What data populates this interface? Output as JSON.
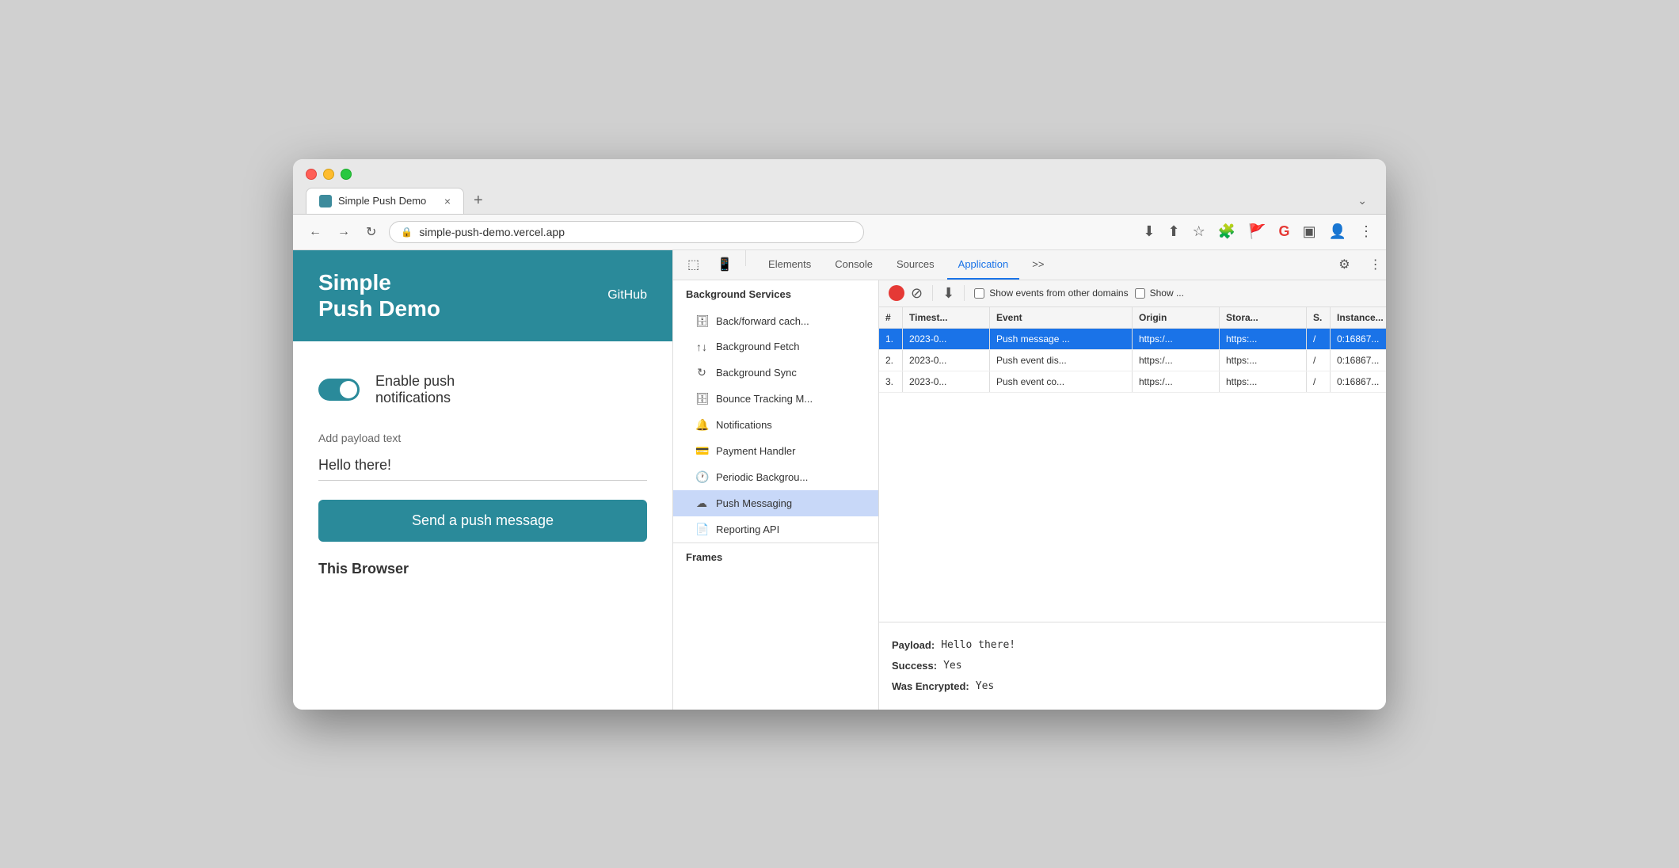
{
  "browser": {
    "tab_title": "Simple Push Demo",
    "tab_close": "×",
    "tab_new": "+",
    "tab_chevron": "⌄",
    "url": "simple-push-demo.vercel.app",
    "nav": {
      "back": "←",
      "forward": "→",
      "refresh": "↻"
    }
  },
  "website": {
    "title_line1": "Simple",
    "title_line2": "Push Demo",
    "github_label": "GitHub",
    "toggle_label": "Enable push\nnotifications",
    "payload_label": "Add payload text",
    "payload_value": "Hello there!",
    "send_button_label": "Send a push message",
    "this_browser": "This Browser"
  },
  "devtools": {
    "tabs": [
      "Elements",
      "Console",
      "Sources",
      "Application"
    ],
    "active_tab": "Application",
    "more_tabs": ">>",
    "section_header": "Background Services",
    "sidebar_items": [
      {
        "label": "Back/forward cache",
        "icon": "🗄"
      },
      {
        "label": "Background Fetch",
        "icon": "↑↓"
      },
      {
        "label": "Background Sync",
        "icon": "↻"
      },
      {
        "label": "Bounce Tracking M...",
        "icon": "🗄"
      },
      {
        "label": "Notifications",
        "icon": "🔔"
      },
      {
        "label": "Payment Handler",
        "icon": "💳"
      },
      {
        "label": "Periodic Backgrou...",
        "icon": "🕐"
      },
      {
        "label": "Push Messaging",
        "icon": "☁"
      },
      {
        "label": "Reporting API",
        "icon": "📄"
      }
    ],
    "active_sidebar": "Push Messaging",
    "frames_label": "Frames",
    "toolbar": {
      "clear_label": "⊘",
      "download_label": "⬇",
      "show_events_label": "Show events from other domains",
      "show_label": "Show ..."
    },
    "table_headers": [
      "#",
      "Timest...",
      "Event",
      "Origin",
      "Stora...",
      "S.",
      "Instance..."
    ],
    "table_rows": [
      {
        "num": "1.",
        "timestamp": "2023-0...",
        "event": "Push message ...",
        "origin": "https:/...",
        "storage": "https:...",
        "s": "/",
        "instance": "0:16867...",
        "selected": true
      },
      {
        "num": "2.",
        "timestamp": "2023-0...",
        "event": "Push event dis...",
        "origin": "https:/...",
        "storage": "https:...",
        "s": "/",
        "instance": "0:16867...",
        "selected": false
      },
      {
        "num": "3.",
        "timestamp": "2023-0...",
        "event": "Push event co...",
        "origin": "https:/...",
        "storage": "https:...",
        "s": "/",
        "instance": "0:16867...",
        "selected": false
      }
    ],
    "detail": {
      "payload_label": "Payload:",
      "payload_value": "Hello there!",
      "success_label": "Success:",
      "success_value": "Yes",
      "encrypted_label": "Was Encrypted:",
      "encrypted_value": "Yes"
    }
  }
}
